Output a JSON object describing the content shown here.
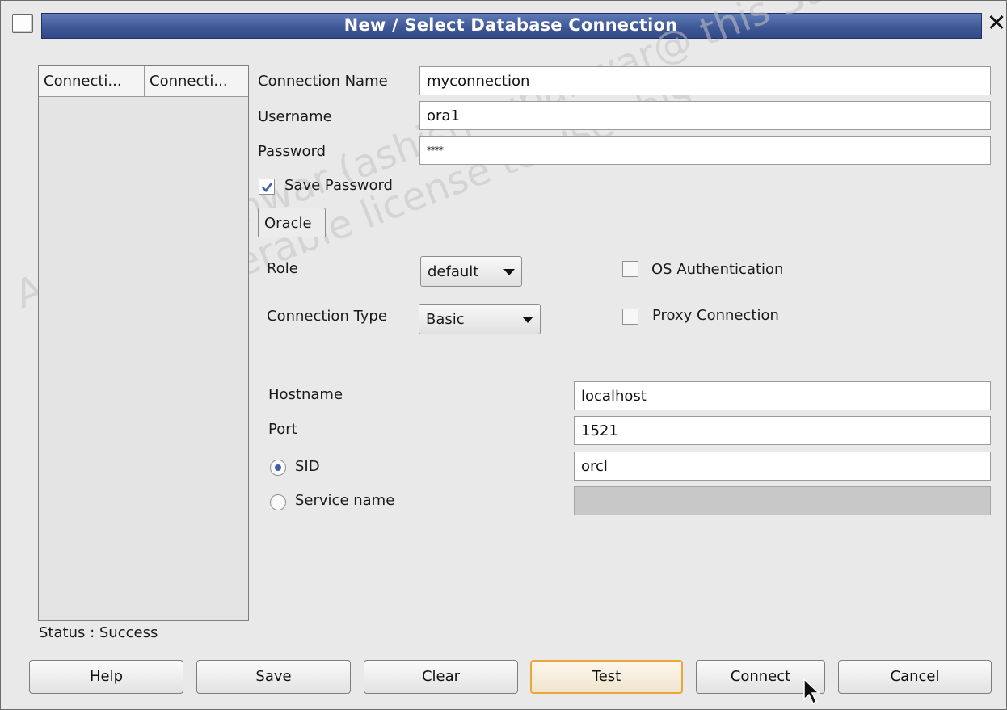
{
  "window": {
    "title": "New / Select Database Connection",
    "close_glyph": "✕"
  },
  "connections_table": {
    "columns": [
      "Connecti...",
      "Connecti..."
    ]
  },
  "form": {
    "connection_name_label": "Connection Name",
    "connection_name_value": "myconnection",
    "username_label": "Username",
    "username_value": "ora1",
    "password_label": "Password",
    "password_value": "****",
    "save_password_label": "Save Password",
    "save_password_checked": true
  },
  "tabs": [
    {
      "label": "Oracle",
      "selected": true
    }
  ],
  "oracle": {
    "role_label": "Role",
    "role_value": "default",
    "connection_type_label": "Connection Type",
    "connection_type_value": "Basic",
    "os_auth_label": "OS Authentication",
    "os_auth_checked": false,
    "proxy_label": "Proxy Connection",
    "proxy_checked": false,
    "hostname_label": "Hostname",
    "hostname_value": "localhost",
    "port_label": "Port",
    "port_value": "1521",
    "sid_label": "SID",
    "sid_value": "orcl",
    "sid_selected": true,
    "service_name_label": "Service name",
    "service_name_value": ""
  },
  "status": "Status : Success",
  "buttons": {
    "help": "Help",
    "save": "Save",
    "clear": "Clear",
    "test": "Test",
    "connect": "Connect",
    "cancel": "Cancel"
  },
  "watermark": {
    "line1": "Ashish Rupanwar (ashish rupanwar@ this Study",
    "line2": "non-transferable license to use this"
  },
  "colors": {
    "title_bar": "#3d5694",
    "focus_outline": "#e8a63b",
    "check_mark": "#3c5fa8"
  }
}
